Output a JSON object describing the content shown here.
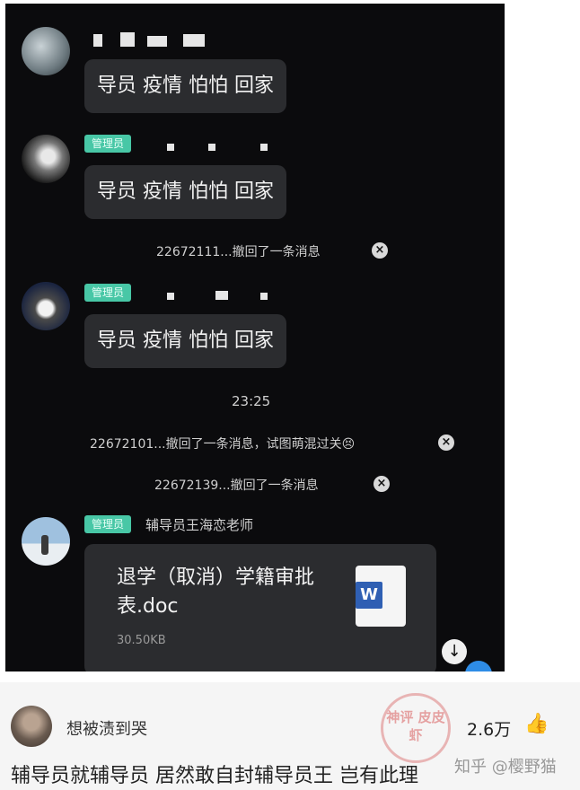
{
  "chat": {
    "messages": [
      {
        "type": "text",
        "text": "导员 疫情 怕怕 回家"
      },
      {
        "type": "text",
        "text": "导员 疫情 怕怕 回家",
        "tag": "管理员"
      },
      {
        "type": "system",
        "text": "22672111...撤回了一条消息",
        "close": "×"
      },
      {
        "type": "text",
        "text": "导员 疫情 怕怕 回家",
        "tag": "管理员"
      },
      {
        "type": "time",
        "text": "23:25"
      },
      {
        "type": "system",
        "text": "22672101...撤回了一条消息，试图萌混过关😣",
        "close": "×"
      },
      {
        "type": "system",
        "text": "22672139...撤回了一条消息",
        "close": "×"
      }
    ],
    "file_message": {
      "tag": "管理员",
      "sender": "辅导员王海恋老师",
      "file_name": "退学（取消）学籍审批表.doc",
      "file_size": "30.50KB",
      "file_icon_letter": "W"
    },
    "scroll_down_icon": "↓"
  },
  "comment": {
    "username": "想被渍到哭",
    "like_count": "2.6万",
    "like_icon": "👍",
    "text": "辅导员就辅导员 居然敢自封辅导员王 岂有此理",
    "stamp": "神评 皮皮虾",
    "watermark": "知乎 @樱野猫"
  },
  "colors": {
    "chat_bg": "#0b0b0d",
    "bubble_bg": "#2b2c2f",
    "admin_tag": "#48c7a6",
    "word_blue": "#2f5fb3"
  }
}
